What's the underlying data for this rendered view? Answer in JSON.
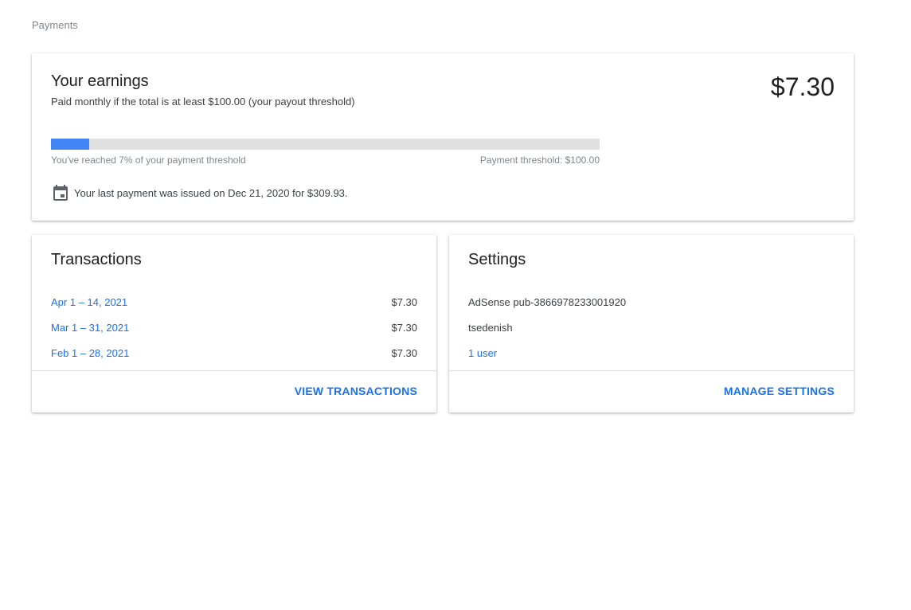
{
  "breadcrumb": "Payments",
  "earnings": {
    "title": "Your earnings",
    "subtitle": "Paid monthly if the total is at least $100.00 (your payout threshold)",
    "amount": "$7.30",
    "progress_percent": 7,
    "progress_left_label": "You've reached 7% of your payment threshold",
    "progress_right_label": "Payment threshold: $100.00",
    "last_payment_text": "Your last payment was issued on Dec 21, 2020 for $309.93.",
    "last_payment_icon": "calendar-icon"
  },
  "transactions": {
    "title": "Transactions",
    "rows": [
      {
        "period": "Apr 1 – 14, 2021",
        "amount": "$7.30"
      },
      {
        "period": "Mar 1 – 31, 2021",
        "amount": "$7.30"
      },
      {
        "period": "Feb 1 – 28, 2021",
        "amount": "$7.30"
      }
    ],
    "action_label": "VIEW TRANSACTIONS"
  },
  "settings": {
    "title": "Settings",
    "publisher_id": "AdSense pub-3866978233001920",
    "account_name": "tsedenish",
    "users_link": "1 user",
    "action_label": "MANAGE SETTINGS"
  },
  "colors": {
    "accent": "#1a73e8",
    "progress_fill": "#4285f4",
    "progress_track": "#e0e0e0"
  }
}
